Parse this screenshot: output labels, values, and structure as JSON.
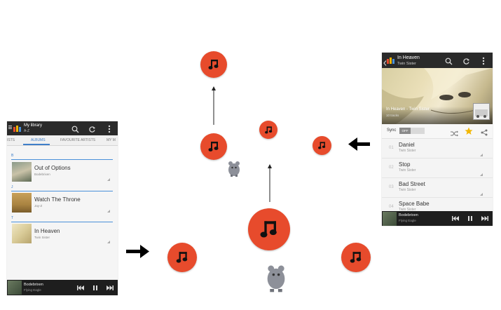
{
  "left_phone": {
    "header": {
      "title": "My library",
      "subtitle": "A-Z"
    },
    "tabs": [
      {
        "label": "ISTS"
      },
      {
        "label": "ALBUMS"
      },
      {
        "label": "FAVOURITE ARTISTS"
      },
      {
        "label": "MY M"
      }
    ],
    "sections": [
      {
        "letter": "B",
        "album": "Out of Options",
        "artist": "Bodebrixen"
      },
      {
        "letter": "J",
        "album": "Watch The Throne",
        "artist": "Jay-Z"
      },
      {
        "letter": "T",
        "album": "In Heaven",
        "artist": "Twin Sister"
      }
    ],
    "player": {
      "title": "Bodebrixen",
      "subtitle": "Flying Eagle"
    }
  },
  "right_phone": {
    "header": {
      "title": "In Heaven",
      "subtitle": "Twin Sister"
    },
    "hero": {
      "title": "In Heaven - Twin Sister",
      "tracks": "10 tracks"
    },
    "sync": {
      "label": "Sync",
      "toggle": "OFF"
    },
    "tracks": [
      {
        "num": "01",
        "title": "Daniel",
        "artist": "Twin Sister"
      },
      {
        "num": "02",
        "title": "Stop",
        "artist": "Twin Sister"
      },
      {
        "num": "03",
        "title": "Bad Street",
        "artist": "Twin Sister"
      },
      {
        "num": "04",
        "title": "Space Babe",
        "artist": "Twin Sister"
      }
    ],
    "player": {
      "title": "Bodebrixen",
      "subtitle": "Flying Eagle"
    }
  },
  "colors": {
    "node": "#e74b2c",
    "accent": "#3f7fc9",
    "star": "#f2b705",
    "robot": "#8d9099"
  },
  "icons": [
    "music-note-icon",
    "robot-icon",
    "arrow-icon",
    "search-icon",
    "refresh-icon",
    "more-icon",
    "shuffle-icon",
    "star-icon",
    "share-icon",
    "play-icon",
    "pause-icon"
  ]
}
